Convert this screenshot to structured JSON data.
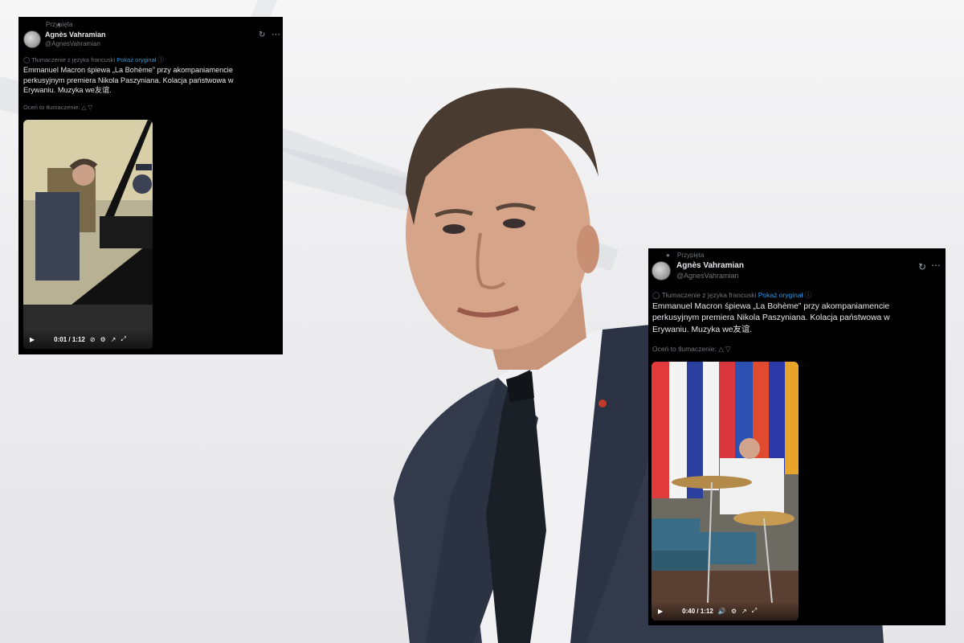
{
  "tweets": [
    {
      "pinned_label": "Przypięta",
      "author_name": "Agnès Vahramian",
      "author_handle": "@AgnesVahramian",
      "translation_note": "Tłumaczenie z języka francuski",
      "show_original": "Pokaż oryginał",
      "text": "Emmanuel Macron śpiewa „La Bohème” przy akompaniamencie perkusyjnym premiera Nikola Paszyniana. Kolacja państwowa w Erywaniu. Muzyka we友谊.",
      "rate_translation": "Oceń to tłumaczenie:",
      "video_time": "0:01 / 1:12"
    },
    {
      "pinned_label": "Przypięta",
      "author_name": "Agnès Vahramian",
      "author_handle": "@AgnesVahramian",
      "translation_note": "Tłumaczenie z języka francuski",
      "show_original": "Pokaż oryginał",
      "text": "Emmanuel Macron śpiewa „La Bohème” przy akompaniamencie perkusyjnym premiera Nikola Paszyniana. Kolacja państwowa w Erywaniu. Muzyka we友谊.",
      "rate_translation": "Oceń to tłumaczenie:",
      "video_time": "0:40 / 1:12"
    }
  ],
  "icons": {
    "pin": "pin-icon",
    "grok": "grok-icon",
    "more": "more-icon",
    "translate": "translate-icon",
    "info": "info-icon",
    "thumbs_up": "thumbs-up-icon",
    "thumbs_down": "thumbs-down-icon",
    "play": "play-icon",
    "mute": "mute-icon",
    "settings": "settings-icon",
    "share": "share-icon",
    "fullscreen": "fullscreen-icon"
  },
  "colors": {
    "card_bg": "#000000",
    "text": "#e7e9ea",
    "muted": "#71767b",
    "link": "#1d9bf0",
    "background": "#ececee"
  }
}
